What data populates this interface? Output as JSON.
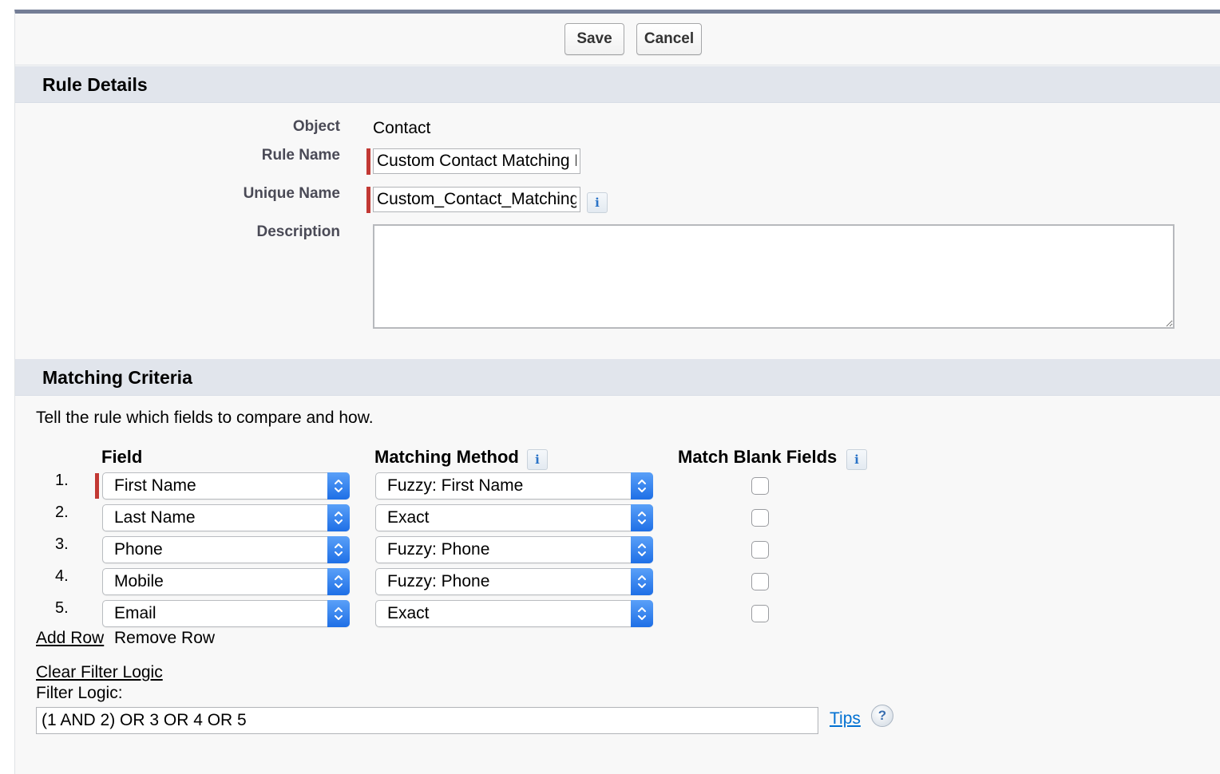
{
  "toolbar": {
    "save_label": "Save",
    "cancel_label": "Cancel"
  },
  "rule_details": {
    "heading": "Rule Details",
    "object_label": "Object",
    "object_value": "Contact",
    "rule_name_label": "Rule Name",
    "rule_name_value": "Custom Contact Matching Rule",
    "unique_name_label": "Unique Name",
    "unique_name_value": "Custom_Contact_Matching_Rule",
    "info_icon": "i",
    "description_label": "Description",
    "description_value": ""
  },
  "matching_criteria": {
    "heading": "Matching Criteria",
    "intro": "Tell the rule which fields to compare and how.",
    "col_field": "Field",
    "col_method": "Matching Method",
    "col_blank": "Match Blank Fields",
    "rows": [
      {
        "num": "1.",
        "field": "First Name",
        "method": "Fuzzy: First Name",
        "match_blank": false
      },
      {
        "num": "2.",
        "field": "Last Name",
        "method": "Exact",
        "match_blank": false
      },
      {
        "num": "3.",
        "field": "Phone",
        "method": "Fuzzy: Phone",
        "match_blank": false
      },
      {
        "num": "4.",
        "field": "Mobile",
        "method": "Fuzzy: Phone",
        "match_blank": false
      },
      {
        "num": "5.",
        "field": "Email",
        "method": "Exact",
        "match_blank": false
      }
    ],
    "add_row": "Add Row",
    "remove_row": "Remove Row",
    "clear_filter_logic": "Clear Filter Logic",
    "filter_logic_label": "Filter Logic:",
    "filter_logic_value": "(1 AND 2) OR 3 OR 4 OR 5",
    "tips": "Tips",
    "help_icon": "?"
  },
  "colors": {
    "required": "#c23934",
    "link": "#0070d2",
    "select_arrow": "#1e6fe6",
    "section_bg": "#e1e5ec"
  }
}
